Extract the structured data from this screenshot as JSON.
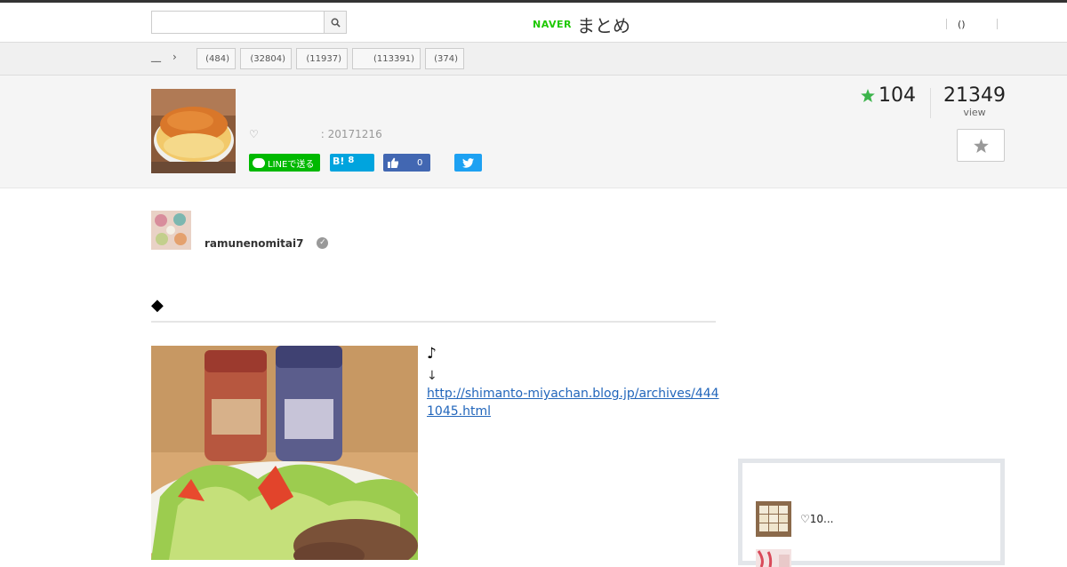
{
  "header": {
    "search_placeholder": "",
    "logo_brand": "NAVER",
    "logo_service": "まとめ",
    "login_label": "()"
  },
  "breadcrumb": {
    "home_label": "__"
  },
  "categories": [
    {
      "label": "(484)"
    },
    {
      "label": "(32804)"
    },
    {
      "label": "(11937)"
    },
    {
      "label": "(113391)"
    },
    {
      "label": "(374)"
    }
  ],
  "article": {
    "meta_heart": "♡",
    "meta_date": ": 20171216",
    "favorites": "104",
    "views": "21349",
    "views_label": "view"
  },
  "share": {
    "line_label": "LINEで送る",
    "hatena_label": "B!",
    "hatena_count": "8",
    "facebook_count": "0"
  },
  "author": {
    "name": "ramunenomitai7",
    "verified_mark": "✓"
  },
  "content": {
    "heading": "◆",
    "note": "♪",
    "arrow": "↓",
    "link": "http://shimanto-miyachan.blog.jp/archives/4441045.html"
  },
  "sidebar": {
    "related_title": "♡10..."
  },
  "colors": {
    "accent_green": "#1ec800",
    "star_green": "#3cb44b",
    "line_green": "#00b900",
    "hatena_blue": "#00a4de",
    "facebook_blue": "#4267b2",
    "twitter_blue": "#1da1f2",
    "link_blue": "#2266bb"
  },
  "icons": [
    "search-icon",
    "chevron-right-icon",
    "star-icon",
    "line-icon",
    "hatena-icon",
    "thumbs-up-icon",
    "twitter-icon",
    "verified-icon"
  ]
}
